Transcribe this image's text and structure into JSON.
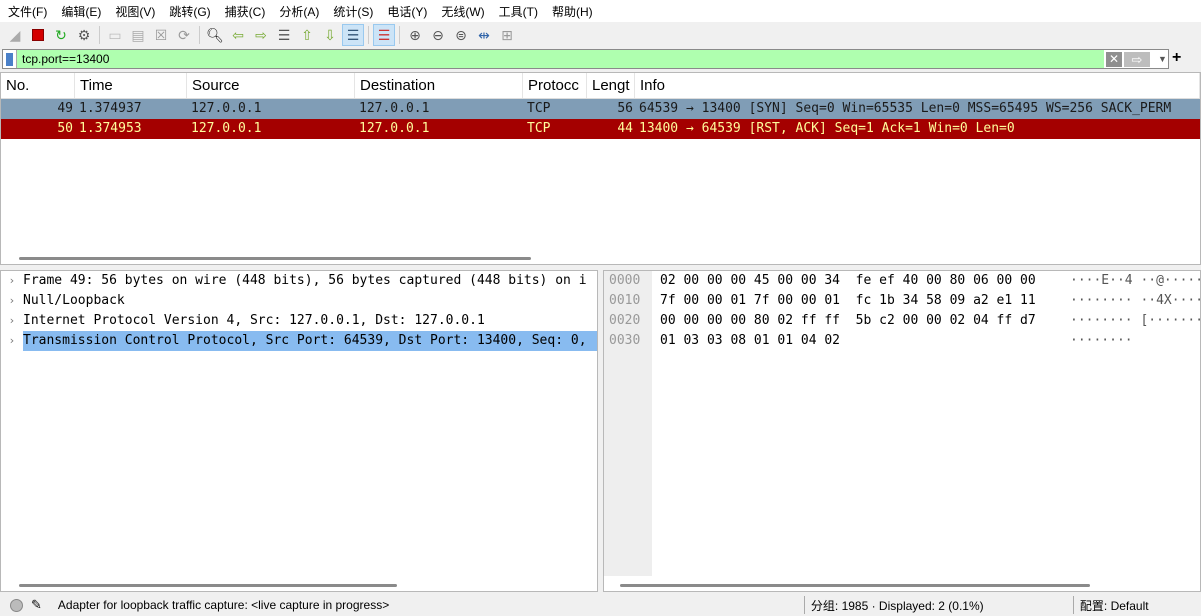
{
  "menu": [
    "文件(F)",
    "编辑(E)",
    "视图(V)",
    "跳转(G)",
    "捕获(C)",
    "分析(A)",
    "统计(S)",
    "电话(Y)",
    "无线(W)",
    "工具(T)",
    "帮助(H)"
  ],
  "toolbar": {
    "icons": [
      "shark-fin-start-icon",
      "stop-capture-icon",
      "restart-capture-icon",
      "capture-options-icon",
      "open-file-icon",
      "save-file-icon",
      "close-file-icon",
      "reload-icon",
      "find-packet-icon",
      "go-back-icon",
      "go-forward-icon",
      "go-to-packet-icon",
      "first-packet-icon",
      "last-packet-icon",
      "autoscroll-icon",
      "colorize-icon",
      "zoom-in-icon",
      "zoom-out-icon",
      "zoom-normal-icon",
      "resize-columns-icon",
      "layout-icon"
    ]
  },
  "filter": {
    "value": "tcp.port==13400",
    "valid_color": "#afffaf"
  },
  "packet_list": {
    "columns": [
      "No.",
      "Time",
      "Source",
      "Destination",
      "Protocc",
      "Lengt",
      "Info"
    ],
    "rows": [
      {
        "no": "49",
        "time": "1.374937",
        "src": "127.0.0.1",
        "dst": "127.0.0.1",
        "proto": "TCP",
        "len": "56",
        "info": "64539 → 13400 [SYN] Seq=0 Win=65535 Len=0 MSS=65495 WS=256 SACK_PERM",
        "color": "#809db6",
        "selected": true
      },
      {
        "no": "50",
        "time": "1.374953",
        "src": "127.0.0.1",
        "dst": "127.0.0.1",
        "proto": "TCP",
        "len": "44",
        "info": "13400 → 64539 [RST, ACK] Seq=1 Ack=1 Win=0 Len=0",
        "color": "#a40000"
      }
    ]
  },
  "details": [
    "Frame 49: 56 bytes on wire (448 bits), 56 bytes captured (448 bits) on i",
    "Null/Loopback",
    "Internet Protocol Version 4, Src: 127.0.0.1, Dst: 127.0.0.1",
    "Transmission Control Protocol, Src Port: 64539, Dst Port: 13400, Seq: 0,"
  ],
  "bytes": [
    {
      "off": "0000",
      "hex": "02 00 00 00 45 00 00 34  fe ef 40 00 80 06 00 00",
      "ascii": "····E··4 ··@·····"
    },
    {
      "off": "0010",
      "hex": "7f 00 00 01 7f 00 00 01  fc 1b 34 58 09 a2 e1 11",
      "ascii": "········ ··4X····"
    },
    {
      "off": "0020",
      "hex": "00 00 00 00 80 02 ff ff  5b c2 00 00 02 04 ff d7",
      "ascii": "········ [·······"
    },
    {
      "off": "0030",
      "hex": "01 03 03 08 01 01 04 02",
      "ascii": "········"
    }
  ],
  "status": {
    "message": "Adapter for loopback traffic capture: <live capture in progress>",
    "packets": "分组: 1985 · Displayed: 2 (0.1%)",
    "profile": "配置: Default"
  }
}
